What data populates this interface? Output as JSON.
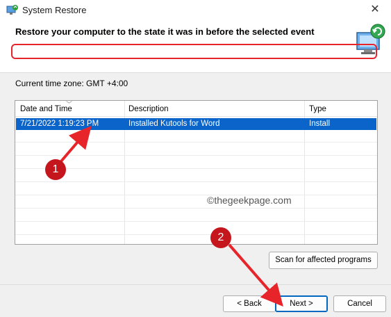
{
  "window": {
    "title": "System Restore",
    "close_glyph": "✕"
  },
  "header": {
    "heading": "Restore your computer to the state it was in before the selected event",
    "icon": "system-restore-icon"
  },
  "timezone": "Current time zone: GMT +4:00",
  "table": {
    "columns": [
      "Date and Time",
      "Description",
      "Type"
    ],
    "rows": [
      {
        "date": "7/21/2022 1:19:23 PM",
        "description": "Installed Kutools for Word",
        "type": "Install",
        "selected": true
      }
    ]
  },
  "buttons": {
    "scan": "Scan for affected programs",
    "back": "< Back",
    "next": "Next >",
    "cancel": "Cancel"
  },
  "watermark": "©thegeekpage.com",
  "annotations": {
    "badge_1": "1",
    "badge_2": "2",
    "color": "#e8242b"
  },
  "colors": {
    "selection": "#0a64c9",
    "accent": "#0067c0"
  }
}
